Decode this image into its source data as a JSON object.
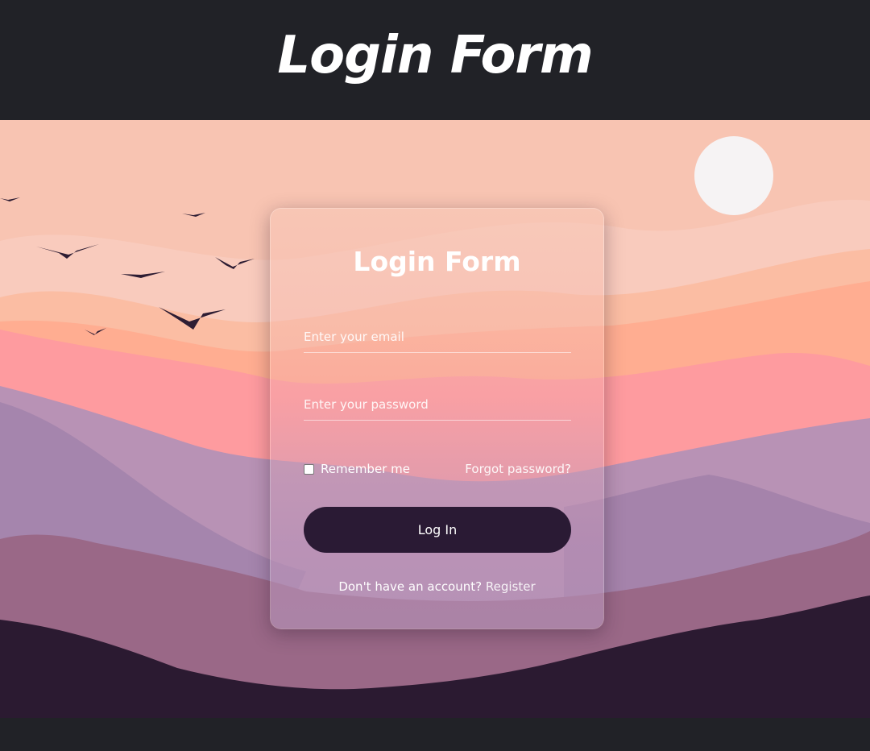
{
  "banner": {
    "title": "Login Form"
  },
  "form": {
    "title": "Login Form",
    "email_placeholder": "Enter your email",
    "password_placeholder": "Enter your password",
    "remember_label": "Remember me",
    "remember_checked": false,
    "forgot_label": "Forgot password?",
    "login_label": "Log In",
    "register_prompt": "Don't have an account?",
    "register_label": "Register"
  },
  "colors": {
    "page_background": "#212227",
    "sky": "#f8c4b2",
    "button": "#2a1a34",
    "text": "#ffffff"
  }
}
